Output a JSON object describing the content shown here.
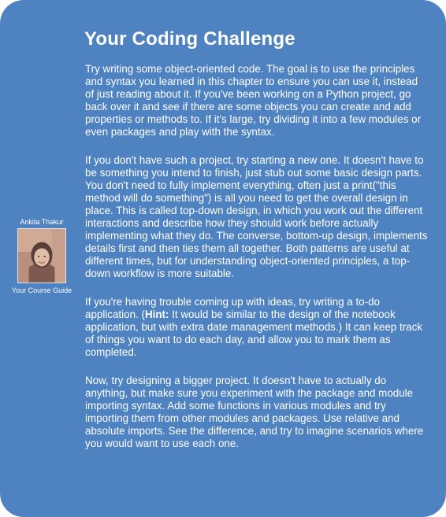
{
  "title": "Your Coding Challenge",
  "guide": {
    "name": "Ankita Thakur",
    "role": "Your Course Guide"
  },
  "paragraphs": {
    "p1": "Try writing some object-oriented code. The goal is to use the principles and syntax you learned in this chapter to ensure you can use it, instead of just reading about it. If you've been working on a Python project, go back over it and see if there are some objects you can create and add properties or methods to. If it's large, try dividing it into a few modules or even packages and play with the syntax.",
    "p2": "If you don't have such a project, try starting a new one. It doesn't have to be something you intend to finish, just stub out some basic design parts. You don't need to fully implement everything, often just a print(\"this method will do something\") is all you need to get the overall design in place. This is called top-down design, in which you work out the different interactions and describe how they should work before actually implementing what they do. The converse, bottom-up design, implements details first and then ties them all together. Both patterns are useful at different times, but for understanding object-oriented principles, a top-down workflow is more suitable.",
    "p3_before": "If you're having trouble coming up with ideas, try writing a to-do application. (",
    "p3_hint_label": "Hint:",
    "p3_after": " It would be similar to the design of the notebook application, but with extra date management methods.) It can keep track of things you want to do each day, and allow you to mark them as completed.",
    "p4": "Now, try designing a bigger project. It doesn't have to actually do anything, but make sure you experiment with the package and module importing syntax. Add some functions in various modules and try importing them from other modules and packages. Use relative and absolute imports. See the difference, and try to imagine scenarios where you would want to use each one."
  },
  "colors": {
    "background": "#4f82c0",
    "text": "#ffffff"
  }
}
